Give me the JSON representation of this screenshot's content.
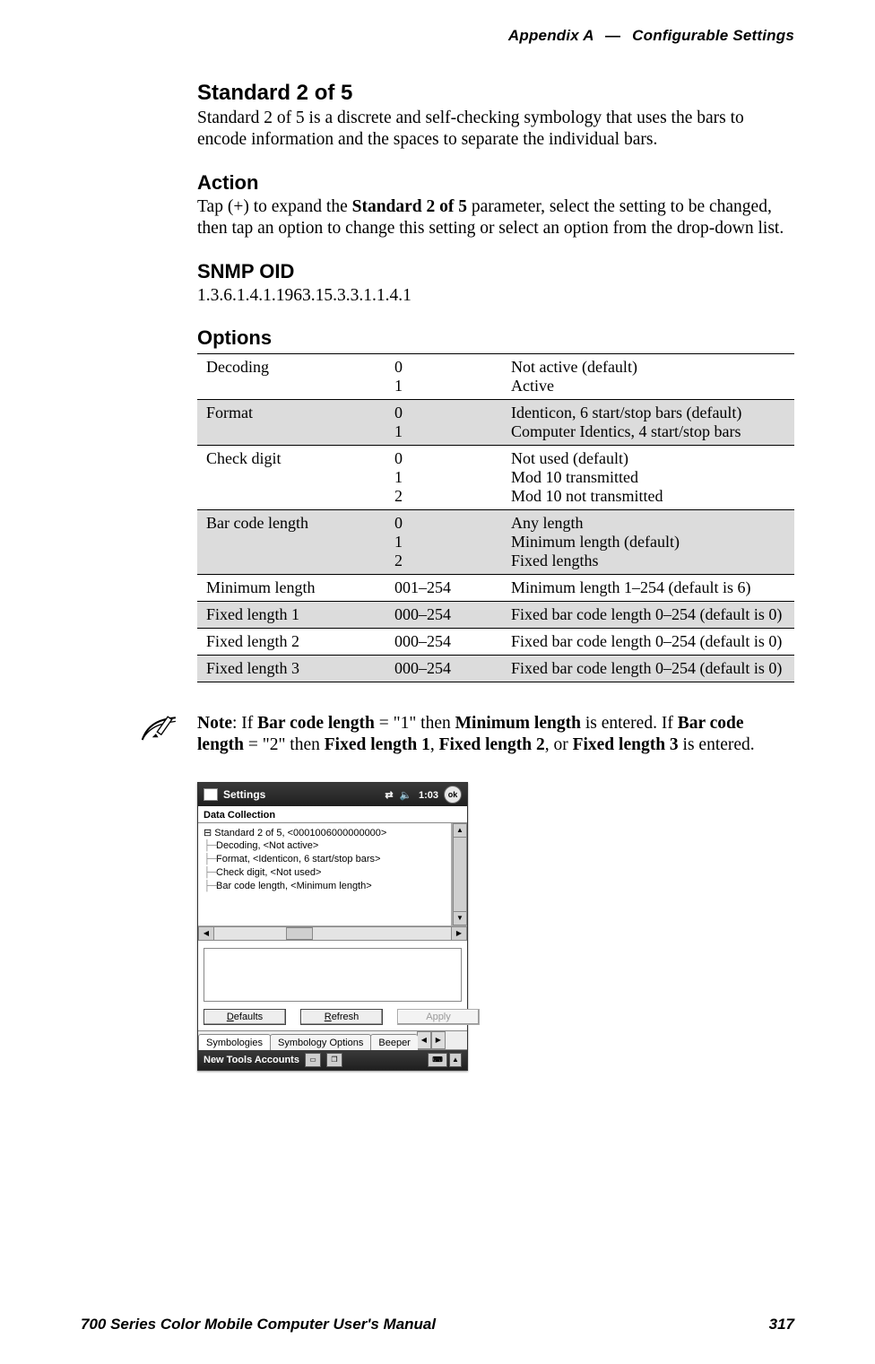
{
  "header": {
    "appendix": "Appendix A",
    "dash": "—",
    "title": "Configurable Settings"
  },
  "sections": {
    "std25": {
      "heading": "Standard 2 of 5",
      "body": "Standard 2 of 5 is a discrete and self-checking symbology that uses the bars to encode information and the spaces to separate the individual bars."
    },
    "action": {
      "heading": "Action",
      "body_pre": "Tap (+) to expand the ",
      "body_bold": "Standard 2 of 5",
      "body_post": " parameter, select the setting to be changed, then tap an option to change this setting or select an option from the drop-down list."
    },
    "snmp": {
      "heading": "SNMP OID",
      "oid": "1.3.6.1.4.1.1963.15.3.3.1.1.4.1"
    },
    "options_heading": "Options"
  },
  "options_table": [
    {
      "name": "Decoding",
      "vals": "0\n1",
      "desc": "Not active (default)\nActive",
      "shaded": false
    },
    {
      "name": "Format",
      "vals": "0\n1",
      "desc": "Identicon, 6 start/stop bars (default)\nComputer Identics, 4 start/stop bars",
      "shaded": true
    },
    {
      "name": "Check digit",
      "vals": "0\n1\n2",
      "desc": "Not used (default)\nMod 10 transmitted\nMod 10 not transmitted",
      "shaded": false
    },
    {
      "name": "Bar code length",
      "vals": "0\n1\n2",
      "desc": "Any length\nMinimum length (default)\nFixed lengths",
      "shaded": true
    },
    {
      "name": "Minimum length",
      "vals": "001–254",
      "desc": "Minimum length 1–254 (default is 6)",
      "shaded": false
    },
    {
      "name": "Fixed length 1",
      "vals": "000–254",
      "desc": "Fixed bar code length 0–254 (default is 0)",
      "shaded": true
    },
    {
      "name": "Fixed length 2",
      "vals": "000–254",
      "desc": "Fixed bar code length 0–254 (default is 0)",
      "shaded": false
    },
    {
      "name": "Fixed length 3",
      "vals": "000–254",
      "desc": "Fixed bar code length 0–254 (default is 0)",
      "shaded": true
    }
  ],
  "note": {
    "label": "Note",
    "t1": ": If ",
    "b1": "Bar code length",
    "t2": " = \"1\" then ",
    "b2": "Minimum length",
    "t3": " is entered. If ",
    "b3": "Bar code length",
    "t4": " = \"2\" then ",
    "b4": "Fixed length 1",
    "t5": ", ",
    "b5": "Fixed length 2",
    "t6": ", or ",
    "b6": "Fixed length 3",
    "t7": " is entered."
  },
  "device": {
    "title": "Settings",
    "time": "1:03",
    "ok": "ok",
    "panel_title": "Data Collection",
    "tree": {
      "root": "Standard 2 of 5, <0001006000000000>",
      "items": [
        "Decoding, <Not active>",
        "Format, <Identicon, 6 start/stop bars>",
        "Check digit, <Not used>",
        "Bar code length, <Minimum length>"
      ]
    },
    "buttons": {
      "defaults": "Defaults",
      "refresh": "Refresh",
      "apply": "Apply"
    },
    "tabs": {
      "t1": "Symbologies",
      "t2": "Symbology Options",
      "t3": "Beeper"
    },
    "bottombar": {
      "items": "New  Tools  Accounts"
    }
  },
  "footer": {
    "left": "700 Series Color Mobile Computer User's Manual",
    "right": "317"
  }
}
